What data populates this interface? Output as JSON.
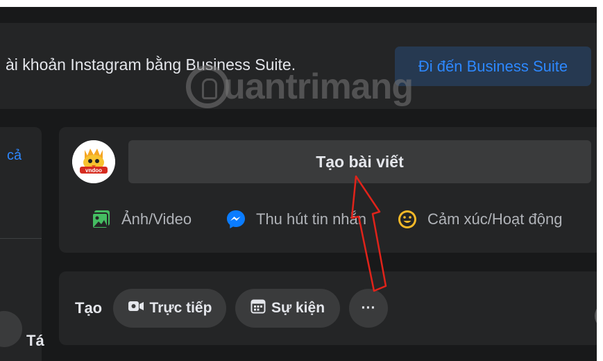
{
  "banner": {
    "text": "ài khoản Instagram bằng Business Suite.",
    "button_label": "Đi đến Business Suite"
  },
  "watermark": {
    "text": "uantrimang"
  },
  "sidebar": {
    "link_label": "cả",
    "name_fragment": "Tá"
  },
  "composer": {
    "avatar_text": "vndoo",
    "create_post_label": "Tạo bài viết",
    "actions": [
      {
        "label": "Ảnh/Video",
        "icon": "photo-video-icon",
        "color": "#45bd62"
      },
      {
        "label": "Thu hút tin nhắn",
        "icon": "messenger-icon",
        "color": "#0a7cff"
      },
      {
        "label": "Cảm xúc/Hoạt động",
        "icon": "emoji-icon",
        "color": "#f7b928"
      }
    ]
  },
  "create_bar": {
    "label": "Tạo",
    "pills": [
      {
        "label": "Trực tiếp",
        "icon": "live-video-icon"
      },
      {
        "label": "Sự kiện",
        "icon": "calendar-icon"
      },
      {
        "label": "···",
        "icon": "more-icon"
      }
    ]
  },
  "colors": {
    "background": "#18191a",
    "card": "#242526",
    "accent_blue": "#2d88ff",
    "annotation_red": "#e0231a"
  }
}
